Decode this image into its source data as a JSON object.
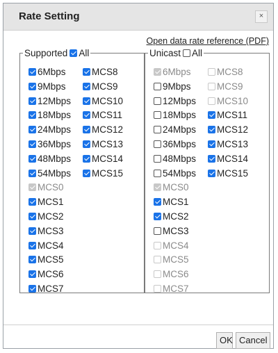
{
  "dialog": {
    "title": "Rate Setting",
    "close_glyph": "×",
    "reference_link": "Open data rate reference (PDF)",
    "ok_label": "OK",
    "cancel_label": "Cancel"
  },
  "supported": {
    "legend": "Supported",
    "all_label": "All",
    "all_checked": true,
    "col1": [
      {
        "label": "6Mbps",
        "checked": true,
        "disabled": false
      },
      {
        "label": "9Mbps",
        "checked": true,
        "disabled": false
      },
      {
        "label": "12Mbps",
        "checked": true,
        "disabled": false
      },
      {
        "label": "18Mbps",
        "checked": true,
        "disabled": false
      },
      {
        "label": "24Mbps",
        "checked": true,
        "disabled": false
      },
      {
        "label": "36Mbps",
        "checked": true,
        "disabled": false
      },
      {
        "label": "48Mbps",
        "checked": true,
        "disabled": false
      },
      {
        "label": "54Mbps",
        "checked": true,
        "disabled": false
      },
      {
        "label": "MCS0",
        "checked": true,
        "disabled": true
      },
      {
        "label": "MCS1",
        "checked": true,
        "disabled": false
      },
      {
        "label": "MCS2",
        "checked": true,
        "disabled": false
      },
      {
        "label": "MCS3",
        "checked": true,
        "disabled": false
      },
      {
        "label": "MCS4",
        "checked": true,
        "disabled": false
      },
      {
        "label": "MCS5",
        "checked": true,
        "disabled": false
      },
      {
        "label": "MCS6",
        "checked": true,
        "disabled": false
      },
      {
        "label": "MCS7",
        "checked": true,
        "disabled": false
      }
    ],
    "col2": [
      {
        "label": "MCS8",
        "checked": true,
        "disabled": false
      },
      {
        "label": "MCS9",
        "checked": true,
        "disabled": false
      },
      {
        "label": "MCS10",
        "checked": true,
        "disabled": false
      },
      {
        "label": "MCS11",
        "checked": true,
        "disabled": false
      },
      {
        "label": "MCS12",
        "checked": true,
        "disabled": false
      },
      {
        "label": "MCS13",
        "checked": true,
        "disabled": false
      },
      {
        "label": "MCS14",
        "checked": true,
        "disabled": false
      },
      {
        "label": "MCS15",
        "checked": true,
        "disabled": false
      }
    ]
  },
  "unicast": {
    "legend": "Unicast",
    "all_label": "All",
    "all_checked": false,
    "col1": [
      {
        "label": "6Mbps",
        "checked": true,
        "disabled": true
      },
      {
        "label": "9Mbps",
        "checked": false,
        "disabled": false
      },
      {
        "label": "12Mbps",
        "checked": false,
        "disabled": false
      },
      {
        "label": "18Mbps",
        "checked": false,
        "disabled": false
      },
      {
        "label": "24Mbps",
        "checked": false,
        "disabled": false
      },
      {
        "label": "36Mbps",
        "checked": false,
        "disabled": false
      },
      {
        "label": "48Mbps",
        "checked": false,
        "disabled": false
      },
      {
        "label": "54Mbps",
        "checked": false,
        "disabled": false
      },
      {
        "label": "MCS0",
        "checked": true,
        "disabled": true
      },
      {
        "label": "MCS1",
        "checked": true,
        "disabled": false
      },
      {
        "label": "MCS2",
        "checked": true,
        "disabled": false
      },
      {
        "label": "MCS3",
        "checked": false,
        "disabled": false
      },
      {
        "label": "MCS4",
        "checked": false,
        "disabled": true
      },
      {
        "label": "MCS5",
        "checked": false,
        "disabled": true
      },
      {
        "label": "MCS6",
        "checked": false,
        "disabled": true
      },
      {
        "label": "MCS7",
        "checked": false,
        "disabled": true
      }
    ],
    "col2": [
      {
        "label": "MCS8",
        "checked": false,
        "disabled": true
      },
      {
        "label": "MCS9",
        "checked": false,
        "disabled": true
      },
      {
        "label": "MCS10",
        "checked": false,
        "disabled": true
      },
      {
        "label": "MCS11",
        "checked": true,
        "disabled": false
      },
      {
        "label": "MCS12",
        "checked": true,
        "disabled": false
      },
      {
        "label": "MCS13",
        "checked": true,
        "disabled": false
      },
      {
        "label": "MCS14",
        "checked": true,
        "disabled": false
      },
      {
        "label": "MCS15",
        "checked": true,
        "disabled": false
      }
    ]
  }
}
